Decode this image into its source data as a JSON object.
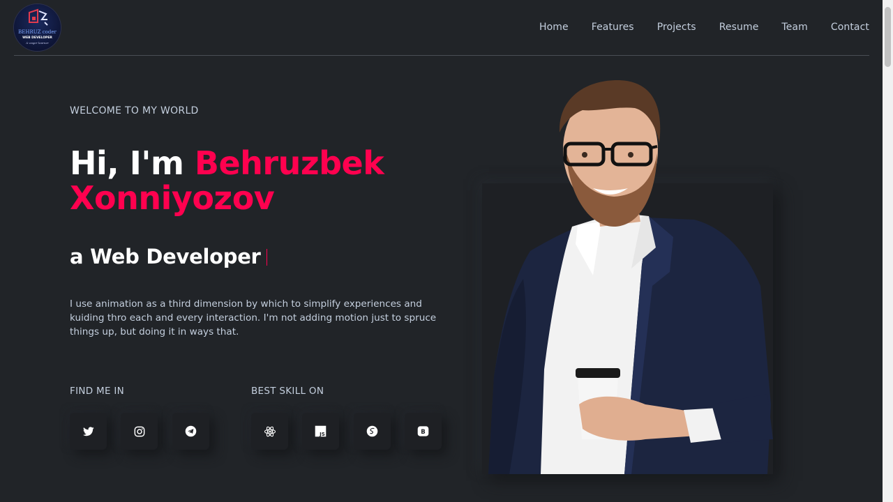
{
  "logo": {
    "name": "BEHRUZ coder",
    "role": "WEB DEVELOPER",
    "subtitle": "& eager learner"
  },
  "nav": {
    "items": [
      "Home",
      "Features",
      "Projects",
      "Resume",
      "Team",
      "Contact"
    ]
  },
  "hero": {
    "welcome": "WELCOME TO MY WORLD",
    "greeting": "Hi, I'm ",
    "name_first": "Behruzbek",
    "name_last": "Xonniyozov",
    "role_prefix": "a ",
    "role": "Web Developer",
    "description": "I use animation as a third dimension by which to simplify experiences and kuiding thro each and every interaction. I'm not adding motion just to spruce things up, but doing it in ways that."
  },
  "social": {
    "label": "FIND ME IN",
    "icons": [
      "twitter-icon",
      "instagram-icon",
      "telegram-icon"
    ]
  },
  "skills": {
    "label": "BEST SKILL ON",
    "icons": [
      "react-icon",
      "javascript-icon",
      "sass-icon",
      "bootstrap-icon"
    ]
  },
  "colors": {
    "background": "#212428",
    "accent": "#ff014f",
    "text": "#c4cfde",
    "heading": "#ffffff",
    "card": "#1e2024"
  }
}
